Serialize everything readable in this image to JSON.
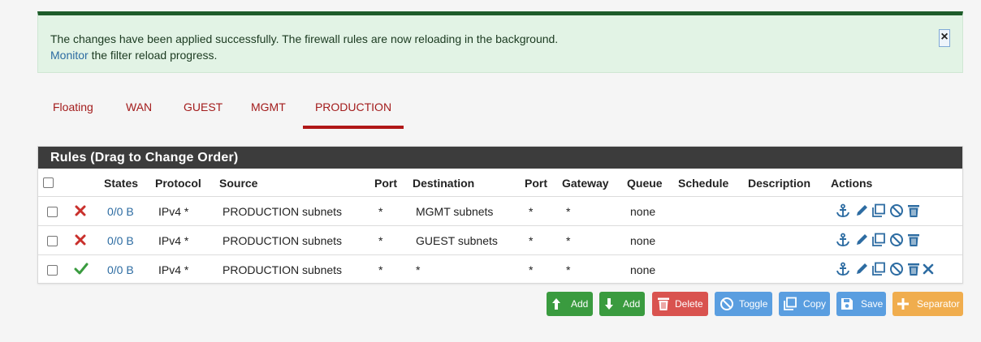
{
  "alert": {
    "line1": "The changes have been applied successfully. The firewall rules are now reloading in the background.",
    "link": "Monitor",
    "line2_rest": " the filter reload progress.",
    "close": "×"
  },
  "tabs": [
    "Floating",
    "WAN",
    "GUEST",
    "MGMT",
    "PRODUCTION"
  ],
  "active_tab": "PRODUCTION",
  "panel": {
    "title": "Rules (Drag to Change Order)",
    "headers": [
      "States",
      "Protocol",
      "Source",
      "Port",
      "Destination",
      "Port",
      "Gateway",
      "Queue",
      "Schedule",
      "Description",
      "Actions"
    ]
  },
  "rules": [
    {
      "status": "block",
      "states": "0/0 B",
      "protocol": "IPv4 *",
      "source": "PRODUCTION subnets",
      "src_port": "*",
      "destination": "MGMT subnets",
      "dst_port": "*",
      "gateway": "*",
      "queue": "none",
      "schedule": "",
      "description": "",
      "actions": [
        "anchor-icon",
        "pencil-icon",
        "copy-icon",
        "disable-icon",
        "trash-icon"
      ]
    },
    {
      "status": "block",
      "states": "0/0 B",
      "protocol": "IPv4 *",
      "source": "PRODUCTION subnets",
      "src_port": "*",
      "destination": "GUEST subnets",
      "dst_port": "*",
      "gateway": "*",
      "queue": "none",
      "schedule": "",
      "description": "",
      "actions": [
        "anchor-icon",
        "pencil-icon",
        "copy-icon",
        "disable-icon",
        "trash-icon"
      ]
    },
    {
      "status": "pass",
      "states": "0/0 B",
      "protocol": "IPv4 *",
      "source": "PRODUCTION subnets",
      "src_port": "*",
      "destination": "*",
      "dst_port": "*",
      "gateway": "*",
      "queue": "none",
      "schedule": "",
      "description": "",
      "actions": [
        "anchor-icon",
        "pencil-icon",
        "copy-icon",
        "disable-icon",
        "trash-icon",
        "delete-x-icon"
      ]
    }
  ],
  "buttons": {
    "add_top": "Add",
    "add_bottom": "Add",
    "delete": "Delete",
    "toggle": "Toggle",
    "copy": "Copy",
    "save": "Save",
    "separator": "Separator"
  },
  "colors": {
    "success_bg": "#e2f3e5",
    "success_border": "#1e5c2a",
    "tab_red": "#a31c1c",
    "panel_header": "#3c3c3c",
    "link_blue": "#2d6ca2",
    "btn_green": "#3a9b3f",
    "btn_red": "#d9534f",
    "btn_blue": "#5a9ee0",
    "btn_orange": "#f0ad4e"
  }
}
